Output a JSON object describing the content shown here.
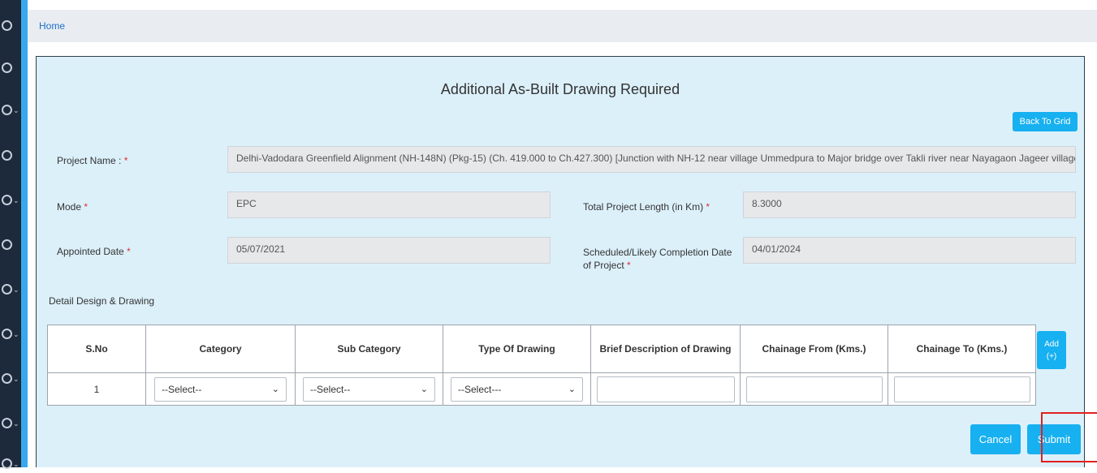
{
  "breadcrumb": {
    "home": "Home"
  },
  "page": {
    "title": "Additional As-Built Drawing Required",
    "back_label": "Back To Grid"
  },
  "form": {
    "project_name": {
      "label": "Project Name : ",
      "value": "Delhi-Vadodara Greenfield Alignment (NH-148N) (Pkg-15) (Ch. 419.000 to Ch.427.300) [Junction with NH-12 near village Ummedpura to Major bridge over Takli river near Nayagaon Jageer village]"
    },
    "mode": {
      "label": "Mode ",
      "value": "EPC"
    },
    "total_length": {
      "label": "Total Project Length (in Km) ",
      "value": "8.3000"
    },
    "appointed_date": {
      "label": "Appointed Date ",
      "value": "05/07/2021"
    },
    "completion_date": {
      "label_line1": "Scheduled/Likely Completion Date",
      "label_line2": "of Project ",
      "value": "04/01/2024"
    },
    "required_mark": "*"
  },
  "section": {
    "title": "Detail Design & Drawing"
  },
  "table": {
    "headers": [
      "S.No",
      "Category",
      "Sub Category",
      "Type Of Drawing",
      "Brief Description of Drawing",
      "Chainage From (Kms.)",
      "Chainage To (Kms.)"
    ],
    "rows": [
      {
        "sno": "1",
        "category": "--Select--",
        "sub_category": "--Select--",
        "type_of_drawing": "--Select---",
        "description": "",
        "chainage_from": "",
        "chainage_to": ""
      }
    ],
    "add_line1": "Add",
    "add_line2": "(+)"
  },
  "actions": {
    "cancel": "Cancel",
    "submit": "Submit"
  },
  "colors": {
    "accent": "#38a8ee",
    "button": "#17b0f0",
    "panel": "#dcf0fa",
    "sidebar": "#1c2a3c",
    "highlight": "#e02020"
  }
}
